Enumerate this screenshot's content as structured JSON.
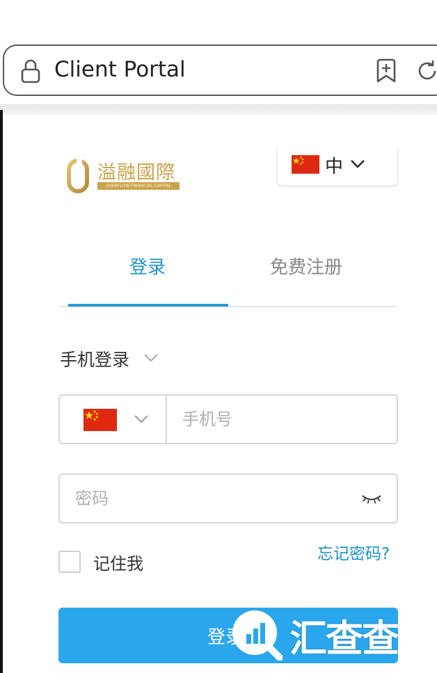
{
  "browser": {
    "title": "Client Portal"
  },
  "header": {
    "logo": {
      "name_cn": "溢融國際",
      "name_en": "OVERFLOW FINANCIAL CAPITAL"
    },
    "language": {
      "label": "中"
    }
  },
  "tabs": [
    {
      "label": "登录",
      "active": true
    },
    {
      "label": "免费注册",
      "active": false
    }
  ],
  "form": {
    "method_label": "手机登录",
    "phone_placeholder": "手机号",
    "password_placeholder": "密码",
    "remember_label": "记住我",
    "forgot_label": "忘记密码?",
    "submit_label": "登录"
  },
  "watermark": {
    "text": "汇查查"
  },
  "colors": {
    "accent": "#2b9bd6",
    "link": "#2090c8",
    "button": "#2aa6ec",
    "logo_gold": "#c8a24a"
  },
  "icons": {
    "lock": "lock-icon",
    "bookmark": "bookmark-add-icon",
    "reload": "reload-icon",
    "language_flag": "china-flag-icon",
    "country_flag": "china-flag-icon",
    "chevron": "chevron-down-icon",
    "password_toggle": "eye-closed-icon"
  }
}
